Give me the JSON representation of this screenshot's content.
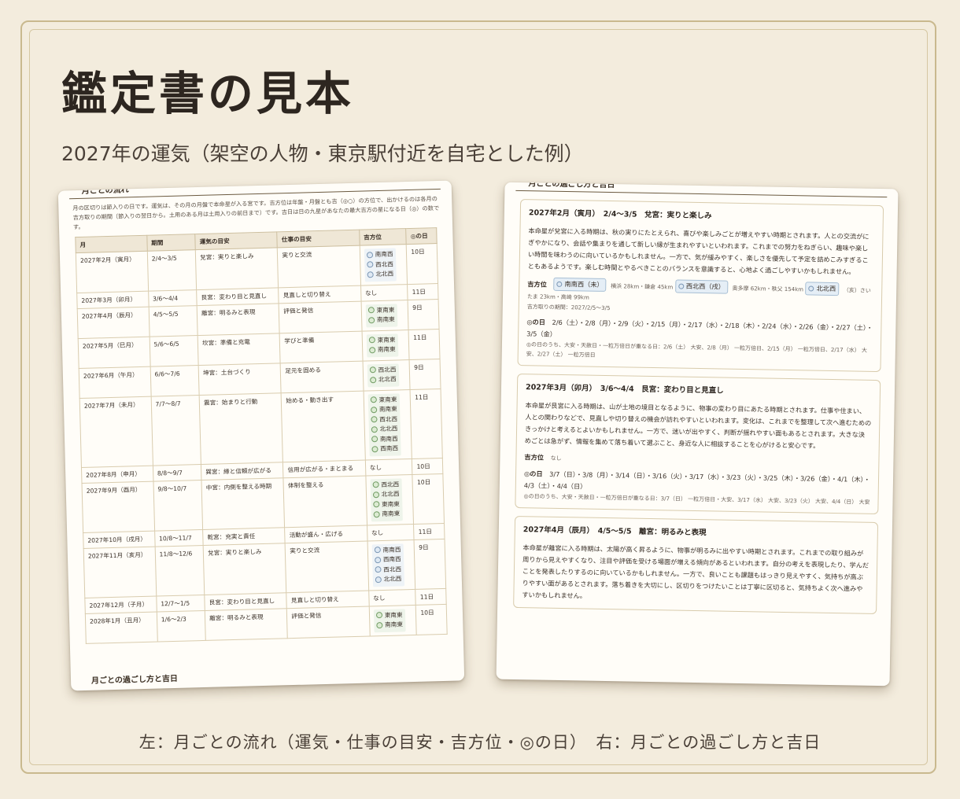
{
  "title": "鑑定書の見本",
  "subtitle": "2027年の運気（架空の人物・東京駅付近を自宅とした例）",
  "caption": "左：月ごとの流れ（運気・仕事の目安・吉方位・◎の日）　右：月ごとの過ごし方と吉日",
  "left_page": {
    "section_title": "月ごとの流れ",
    "intro": "月の区切りは節入りの日です。運気は、その月の月盤で本命星が入る宮です。吉方位は年盤・月盤とも吉（◎○）の方位で、出かけるのは各月の吉方取りの期間（節入りの翌日から。土用のある月は土用入りの前日まで）です。吉日は日の九星があなたの最大吉方の星になる日（◎）の数です。",
    "headers": [
      "月",
      "期間",
      "運気の目安",
      "仕事の目安",
      "吉方位",
      "◎の日"
    ],
    "rows": [
      {
        "month": "2027年2月（寅月）",
        "period": "2/4〜3/5",
        "luck": "兌宮：実りと楽しみ",
        "work": "実りと交流",
        "dirs": [
          "南南西",
          "西北西",
          "北北西"
        ],
        "dir_color": "blue",
        "days": "10日"
      },
      {
        "month": "2027年3月（卯月）",
        "period": "3/6〜4/4",
        "luck": "艮宮：変わり目と見直し",
        "work": "見直しと切り替え",
        "dirs": [],
        "none_label": "なし",
        "dir_color": "blue",
        "days": "11日"
      },
      {
        "month": "2027年4月（辰月）",
        "period": "4/5〜5/5",
        "luck": "離宮：明るみと表現",
        "work": "評価と発信",
        "dirs": [
          "東南東",
          "南南東"
        ],
        "dir_color": "green",
        "days": "9日"
      },
      {
        "month": "2027年5月（巳月）",
        "period": "5/6〜6/5",
        "luck": "坎宮：準備と充電",
        "work": "学びと準備",
        "dirs": [
          "東南東",
          "南南東"
        ],
        "dir_color": "green",
        "days": "11日"
      },
      {
        "month": "2027年6月（午月）",
        "period": "6/6〜7/6",
        "luck": "坤宮：土台づくり",
        "work": "足元を固める",
        "dirs": [
          "西北西",
          "北北西"
        ],
        "dir_color": "green",
        "days": "9日"
      },
      {
        "month": "2027年7月（未月）",
        "period": "7/7〜8/7",
        "luck": "震宮：始まりと行動",
        "work": "始める・動き出す",
        "dirs": [
          "東南東",
          "南南東",
          "西北西",
          "北北西",
          "南南西",
          "西南西"
        ],
        "dir_color": "green",
        "days": "11日"
      },
      {
        "month": "2027年8月（申月）",
        "period": "8/8〜9/7",
        "luck": "巽宮：縁と信頼が広がる",
        "work": "信用が広がる・まとまる",
        "dirs": [],
        "none_label": "なし",
        "dir_color": "blue",
        "days": "10日"
      },
      {
        "month": "2027年9月（酉月）",
        "period": "9/8〜10/7",
        "luck": "中宮：内側を整える時期",
        "work": "体制を整える",
        "dirs": [
          "西北西",
          "北北西",
          "東南東",
          "南南東"
        ],
        "dir_color": "green",
        "days": "10日"
      },
      {
        "month": "2027年10月（戌月）",
        "period": "10/8〜11/7",
        "luck": "乾宮：充実と責任",
        "work": "活動が盛ん・広げる",
        "dirs": [],
        "none_label": "なし",
        "dir_color": "blue",
        "days": "11日"
      },
      {
        "month": "2027年11月（亥月）",
        "period": "11/8〜12/6",
        "luck": "兌宮：実りと楽しみ",
        "work": "実りと交流",
        "dirs": [
          "南南西",
          "西南西",
          "西北西",
          "北北西"
        ],
        "dir_color": "blue",
        "days": "9日"
      },
      {
        "month": "2027年12月（子月）",
        "period": "12/7〜1/5",
        "luck": "艮宮：変わり目と見直し",
        "work": "見直しと切り替え",
        "dirs": [],
        "none_label": "なし",
        "dir_color": "blue",
        "days": "11日"
      },
      {
        "month": "2028年1月（丑月）",
        "period": "1/6〜2/3",
        "luck": "離宮：明るみと表現",
        "work": "評価と発信",
        "dirs": [
          "東南東",
          "南南東"
        ],
        "dir_color": "green",
        "days": "10日"
      }
    ],
    "footer_section_title": "月ごとの過ごし方と吉日"
  },
  "right_page": {
    "section_title": "月ごとの過ごし方と吉日",
    "cards": [
      {
        "title": "2027年2月（寅月）　2/4〜3/5　兌宮：実りと楽しみ",
        "body": "本命星が兌宮に入る時期は、秋の実りにたとえられ、喜びや楽しみごとが増えやすい時期とされます。人との交流がにぎやかになり、会話や集まりを通して新しい縁が生まれやすいといわれます。これまでの努力をねぎらい、趣味や楽しい時間を味わうのに向いているかもしれません。一方で、気が緩みやすく、楽しさを優先して予定を詰めこみすぎることもあるようです。楽しむ時間とやるべきことのバランスを意識すると、心地よく過ごしやすいかもしれません。",
        "dir_label": "吉方位",
        "dir_chips": [
          "南南西（未）",
          "西北西（戌）",
          "北北西"
        ],
        "dir_notes": [
          "横浜 28km・鎌倉 45km",
          "奥多摩 62km・秩父 154km"
        ],
        "dir_note_tail": "（亥）さいたま 23km・高崎 99km",
        "period_note": "吉方取りの期間：2027/2/5〜3/5",
        "days_label": "◎の日",
        "days": "2/6（土）・2/8（月）・2/9（火）・2/15（月）・2/17（水）・2/18（木）・2/24（水）・2/26（金）・2/27（土）・3/5（金）",
        "days_note": "◎の日のうち、大安・天赦日・一粒万倍日が重なる日：2/6（土） 大安、2/8（月） 一粒万倍日、2/15（月） 一粒万倍日、2/17（水） 大安、2/27（土） 一粒万倍日"
      },
      {
        "title": "2027年3月（卯月）　3/6〜4/4　艮宮：変わり目と見直し",
        "body": "本命星が艮宮に入る時期は、山が土地の境目となるように、物事の変わり目にあたる時期とされます。仕事や住まい、人との関わりなどで、見直しや切り替えの機会が訪れやすいといわれます。変化は、これまでを整理して次へ進むためのきっかけと考えるとよいかもしれません。一方で、迷いが出やすく、判断が揺れやすい面もあるとされます。大きな決めごとは急がず、情報を集めて落ち着いて選ぶこと、身近な人に相談することを心がけると安心です。",
        "dir_label": "吉方位",
        "dir_none": "なし",
        "days_label": "◎の日",
        "days": "3/7（日）・3/8（月）・3/14（日）・3/16（火）・3/17（水）・3/23（火）・3/25（木）・3/26（金）・4/1（木）・4/3（土）・4/4（日）",
        "days_note": "◎の日のうち、大安・天赦日・一粒万倍日が重なる日：3/7（日） 一粒万倍日・大安、3/17（水） 大安、3/23（火） 大安、4/4（日） 大安"
      },
      {
        "title": "2027年4月（辰月）　4/5〜5/5　離宮：明るみと表現",
        "body": "本命星が離宮に入る時期は、太陽が高く昇るように、物事が明るみに出やすい時期とされます。これまでの取り組みが周りから見えやすくなり、注目や評価を受ける場面が増える傾向があるといわれます。自分の考えを表現したり、学んだことを発表したりするのに向いているかもしれません。一方で、良いことも課題もはっきり見えやすく、気持ちが高ぶりやすい面があるとされます。落ち着きを大切にし、区切りをつけたいことは丁寧に区切ると、気持ちよく次へ進みやすいかもしれません。"
      }
    ]
  }
}
